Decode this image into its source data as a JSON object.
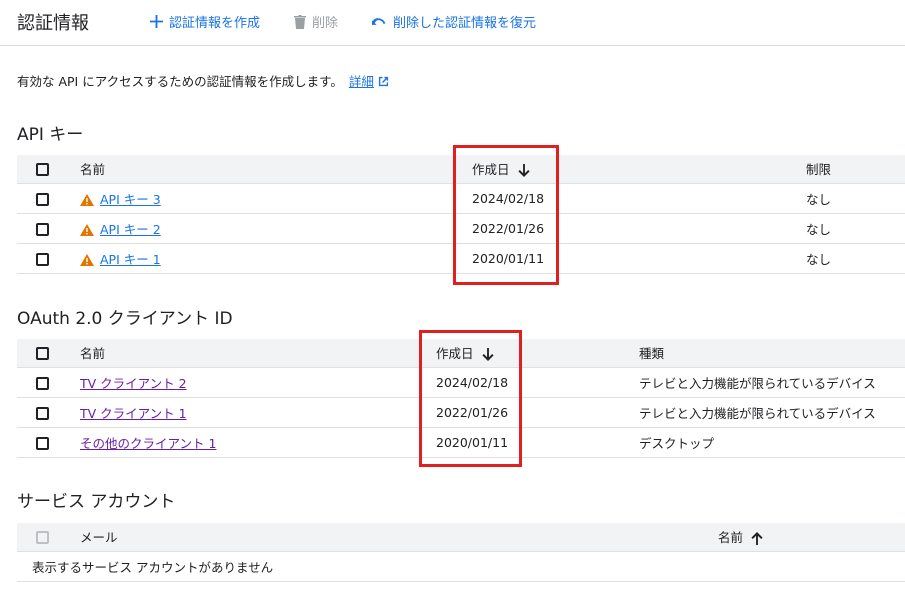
{
  "toolbar": {
    "title": "認証情報",
    "create_label": "認証情報を作成",
    "delete_label": "削除",
    "restore_label": "削除した認証情報を復元"
  },
  "intro": {
    "text": "有効な API にアクセスするための認証情報を作成します。",
    "link": "詳細"
  },
  "api_keys": {
    "title": "API キー",
    "columns": {
      "name": "名前",
      "created": "作成日",
      "restrictions": "制限"
    },
    "rows": [
      {
        "name": "API キー 3",
        "created": "2024/02/18",
        "restrictions": "なし"
      },
      {
        "name": "API キー 2",
        "created": "2022/01/26",
        "restrictions": "なし"
      },
      {
        "name": "API キー 1",
        "created": "2020/01/11",
        "restrictions": "なし"
      }
    ]
  },
  "oauth": {
    "title": "OAuth 2.0 クライアント ID",
    "columns": {
      "name": "名前",
      "created": "作成日",
      "type": "種類"
    },
    "rows": [
      {
        "name": "TV クライアント 2",
        "created": "2024/02/18",
        "type": "テレビと入力機能が限られているデバイス"
      },
      {
        "name": "TV クライアント 1",
        "created": "2022/01/26",
        "type": "テレビと入力機能が限られているデバイス"
      },
      {
        "name": "その他のクライアント 1",
        "created": "2020/01/11",
        "type": "デスクトップ"
      }
    ]
  },
  "service_accounts": {
    "title": "サービス アカウント",
    "columns": {
      "email": "メール",
      "name": "名前"
    },
    "empty_message": "表示するサービス アカウントがありません"
  },
  "colors": {
    "accent": "#1a73e8",
    "visited_link": "#681da8",
    "warning": "#e37400",
    "highlight": "#e0201f"
  }
}
